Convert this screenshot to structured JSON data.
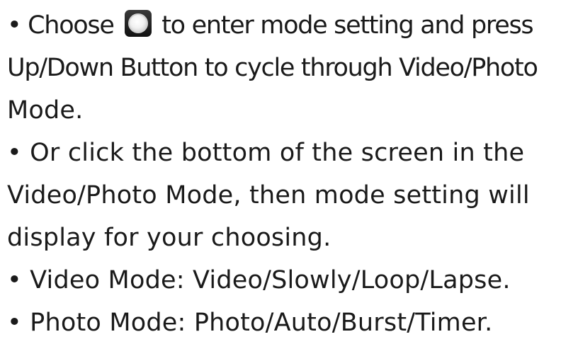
{
  "document": {
    "lines": {
      "l1_pre": "• Choose",
      "l1_post": "to enter mode setting and press",
      "l2": "Up/Down Button to cycle through Video/Photo",
      "l3": "Mode.",
      "l4": "• Or click the bottom of the screen in the",
      "l5": "Video/Photo Mode, then mode setting will",
      "l6": "display for your choosing.",
      "l7": "• Video Mode: Video/Slowly/Loop/Lapse.",
      "l8": "• Photo Mode: Photo/Auto/Burst/Timer."
    },
    "icon": "mode-dial-icon"
  }
}
